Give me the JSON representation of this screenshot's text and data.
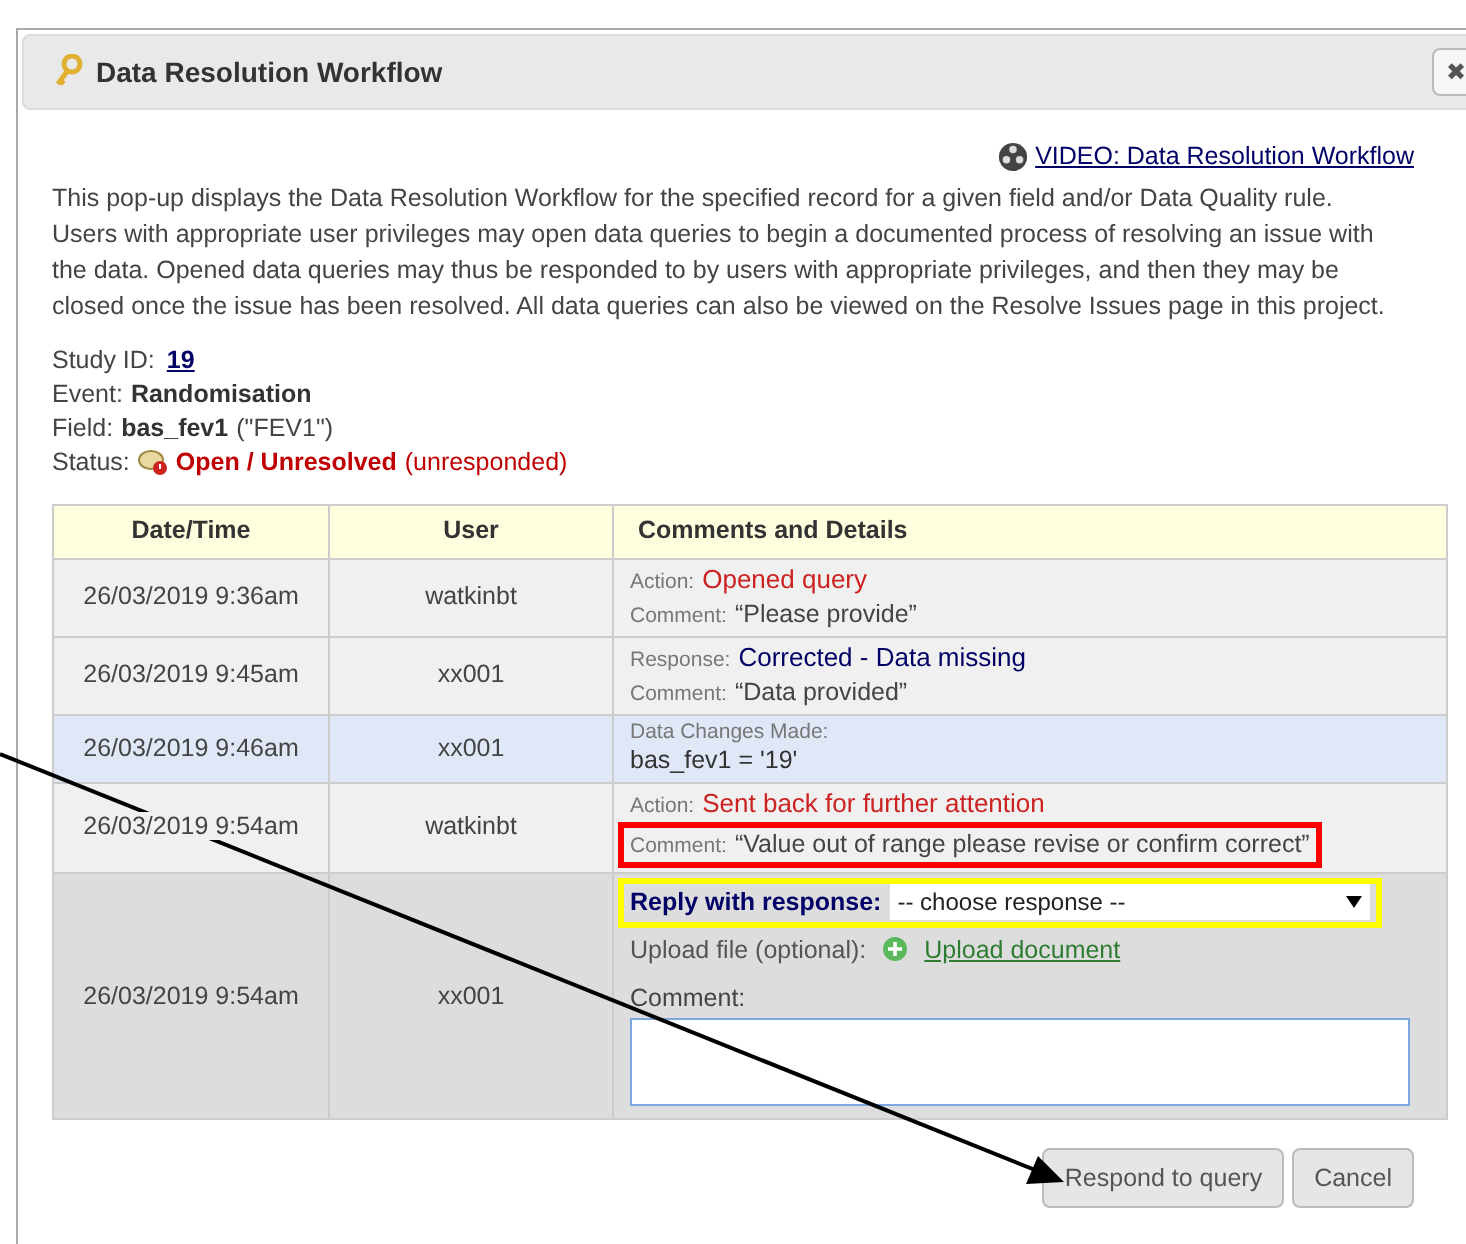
{
  "window": {
    "title": "Data Resolution Workflow",
    "close": "✖"
  },
  "video_link": "VIDEO: Data Resolution Workflow",
  "description": "This pop-up displays the Data Resolution Workflow for the specified record for a given field and/or Data Quality rule. Users with appropriate user privileges may open data queries to begin a documented process of resolving an issue with the data. Opened data queries may thus be responded to by users with appropriate privileges, and then they may be closed once the issue has been resolved. All data queries can also be viewed on the Resolve Issues page in this project.",
  "record": {
    "study_id_label": "Study ID:",
    "study_id": "19",
    "event_label": "Event:",
    "event": "Randomisation",
    "field_label": "Field:",
    "field": "bas_fev1",
    "field_note": "(\"FEV1\")",
    "status_label": "Status:",
    "status": "Open / Unresolved",
    "status_note": "(unresponded)"
  },
  "table": {
    "columns": [
      "Date/Time",
      "User",
      "Comments and Details"
    ],
    "rows": [
      {
        "kind": "action",
        "date": "26/03/2019 9:36am",
        "user": "watkinbt",
        "label": "Action:",
        "value": "Opened query",
        "comment_label": "Comment:",
        "comment": "“Please provide”"
      },
      {
        "kind": "response",
        "date": "26/03/2019 9:45am",
        "user": "xx001",
        "label": "Response:",
        "value": "Corrected - Data missing",
        "comment_label": "Comment:",
        "comment": "“Data provided”"
      },
      {
        "kind": "changes",
        "date": "26/03/2019 9:46am",
        "user": "xx001",
        "label": "Data Changes Made:",
        "value": "bas_fev1 = '19'"
      },
      {
        "kind": "action",
        "date": "26/03/2019 9:54am",
        "user": "watkinbt",
        "label": "Action:",
        "value": "Sent back for further attention",
        "comment_label": "Comment:",
        "comment": "“Value out of range please revise or confirm correct”"
      },
      {
        "kind": "reply",
        "date": "26/03/2019 9:54am",
        "user": "xx001",
        "reply_label": "Reply with response:",
        "select": "-- choose response --",
        "upload_label": "Upload file (optional):",
        "upload_link": "Upload document",
        "comment_label": "Comment:"
      }
    ]
  },
  "buttons": [
    "Respond to query",
    "Cancel"
  ],
  "annotations": [
    {
      "kind": "box",
      "color": "#ff0000"
    },
    {
      "kind": "box",
      "color": "#ffff00"
    },
    {
      "kind": "arrow",
      "color": "#000000"
    }
  ]
}
